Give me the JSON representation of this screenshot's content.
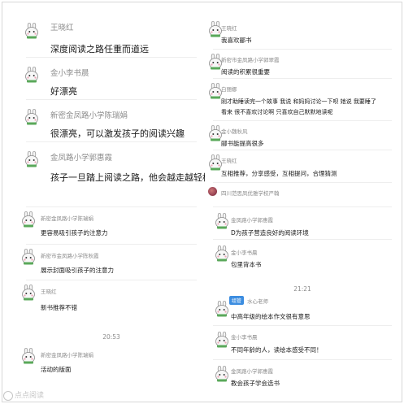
{
  "left_panel": {
    "large_messages": [
      {
        "name": "王晓红",
        "text": "深度阅读之路任重而道远"
      },
      {
        "name": "金小李书晨",
        "text": "好漂亮"
      },
      {
        "name": "新密金凤路小学陈瑞娟",
        "text": "很漂亮，可以激发孩子的阅读兴趣"
      },
      {
        "name": "金凤路小学郭惠霞",
        "text": "孩子一旦踏上阅读之路，他会越走越轻松"
      }
    ],
    "small_messages": [
      {
        "name": "新密金凤路小学陈瑞娟",
        "text": "更容易吸引孩子的注意力"
      },
      {
        "name": "新密市金凤路小学陈秋霞",
        "text": "展示封面吸引孩子的注意力"
      },
      {
        "name": "王晓红",
        "text": "新书推荐不错"
      }
    ],
    "time": "20:53",
    "after_time_messages": [
      {
        "name": "新密金凤路小学陈瑞娟",
        "text": "活动的版面"
      }
    ]
  },
  "right_panel": {
    "messages_top": [
      {
        "name": "王晓红",
        "text": "我喜欢郦书"
      },
      {
        "name": "新密市金凤路小学郭翠霞",
        "text": "阅读的积累很重要"
      },
      {
        "name": "白丽娜",
        "text": "刚才助睡读完一个故事 我说 和妈妈讨论一下呗 她说 我要睡了",
        "text2": "看来 很不喜欢讨论啊 只喜欢自己默默地读呢"
      },
      {
        "name": "金小魏秋风",
        "text": "郦书能提高很多"
      },
      {
        "name": "王晓红",
        "text": "互相推荐，分享感受，互相提问，合理猜测"
      }
    ],
    "photo_message": {
      "name": "四川范思凤优雅学校严翰"
    },
    "messages_mid": [
      {
        "name": "金凤路小学郭惠霞",
        "text": "D为孩子营造良好的阅读环境"
      },
      {
        "name": "金小李书晨",
        "text": "包里背本书"
      }
    ],
    "time": "21:21",
    "messages_bottom": [
      {
        "badge": "组管",
        "name": "水心老师",
        "text": "中高年级的绘本作文很有意思"
      },
      {
        "name": "金小李书晨",
        "text": "不同年龄的人，读绘本感受不同！"
      },
      {
        "name": "金凤路小学郭惠霞",
        "text": "教会孩子学会选书"
      }
    ]
  },
  "watermark": "点点阅读",
  "colors": {
    "name_gray": "#8c8c8c",
    "badge_blue": "#3c8de0",
    "text": "#1a1a1a"
  }
}
